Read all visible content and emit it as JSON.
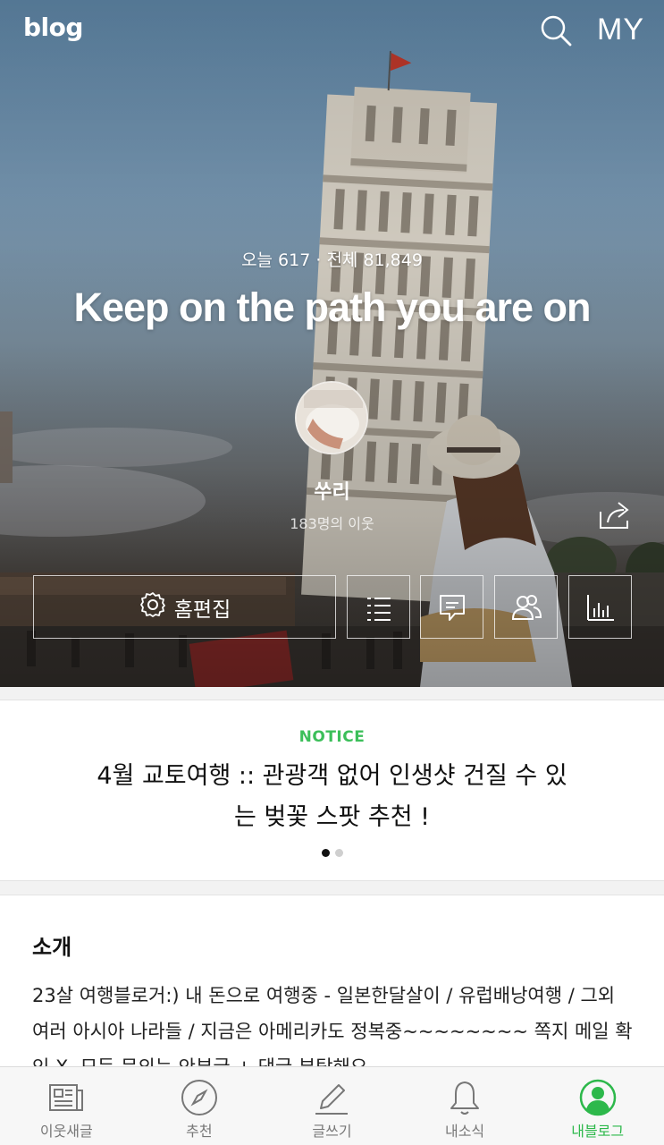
{
  "header": {
    "logo": "blog",
    "search_icon": "search-icon",
    "my_label": "MY"
  },
  "profile": {
    "stats": "오늘 617 · 전체 81,849",
    "title": "Keep on the path you are on",
    "nickname": "쑤리",
    "neighbors": "183명의 이웃"
  },
  "actions": {
    "home_edit_label": "홈편집",
    "icons": [
      "gear-icon",
      "list-icon",
      "comment-icon",
      "neighbors-icon",
      "stats-icon",
      "share-icon"
    ]
  },
  "notice": {
    "label": "NOTICE",
    "title": "4월 교토여행 :: 관광객 없어 인생샷 건질 수 있는 벚꽃 스팟 추천 !",
    "slide_count": 2,
    "active_slide": 1
  },
  "intro": {
    "heading": "소개",
    "body": "23살 여행블로거:) 내 돈으로 여행중 - 일본한달살이 / 유럽배낭여행 / 그외 여러 아시아 나라들 / 지금은 아메리카도 정복중~~~~~~~~ 쪽지 메일 확인 X. 모든 문의는 안부글 + 댓글 부탁해요"
  },
  "bottom_nav": {
    "items": [
      {
        "label": "이웃새글",
        "icon": "newspaper-icon"
      },
      {
        "label": "추천",
        "icon": "compass-icon"
      },
      {
        "label": "글쓰기",
        "icon": "pencil-icon"
      },
      {
        "label": "내소식",
        "icon": "bell-icon"
      },
      {
        "label": "내블로그",
        "icon": "person-icon"
      }
    ],
    "active_index": 4
  },
  "colors": {
    "accent_green": "#3cbf5a",
    "nav_active": "#2db84b"
  }
}
